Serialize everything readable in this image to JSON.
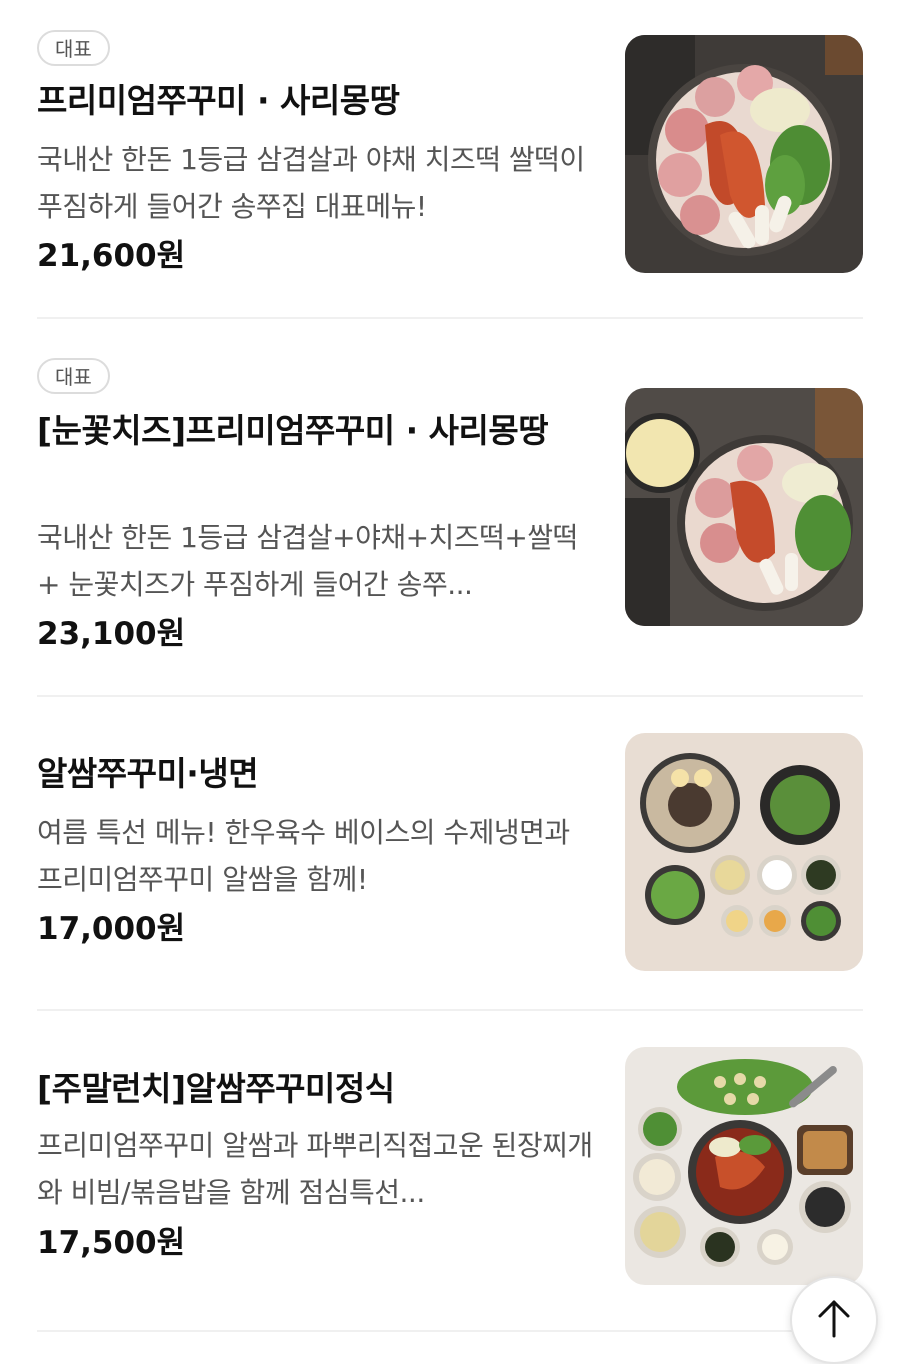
{
  "menu": {
    "items": [
      {
        "badge": "대표",
        "title": "프리미엄쭈꾸미 · 사리몽땅",
        "description": "국내산 한돈 1등급 삼겹살과 야채 치즈떡 쌀떡이 푸짐하게 들어간 송쭈집 대표메뉴!",
        "price": "21,600원",
        "image_icon": "premium-jjukkumi-dish-photo"
      },
      {
        "badge": "대표",
        "title": "[눈꽃치즈]프리미엄쭈꾸미 · 사리몽땅",
        "description": "국내산 한돈 1등급 삼겹살+야채+치즈떡+쌀떡+ 눈꽃치즈가 푸짐하게 들어간 송쭈...",
        "price": "23,100원",
        "image_icon": "snow-cheese-jjukkumi-dish-photo"
      },
      {
        "badge": "",
        "title": "알쌈쭈꾸미·냉면",
        "description": "여름 특선 메뉴! 한우육수 베이스의 수제냉면과 프리미엄쭈꾸미 알쌈을 함께!",
        "price": "17,000원",
        "image_icon": "naengmyeon-set-photo"
      },
      {
        "badge": "",
        "title": "[주말런치]알쌈쭈꾸미정식",
        "description": "프리미엄쭈꾸미 알쌈과 파뿌리직접고운 된장찌개와 비빔/볶음밥을 함께 점심특선...",
        "price": "17,500원",
        "image_icon": "weekend-lunch-set-photo"
      }
    ]
  },
  "scroll_top": {
    "icon": "arrow-up-icon"
  },
  "colors": {
    "text_primary": "#111111",
    "text_secondary": "#555555",
    "badge_border": "#dcdcdc",
    "divider": "#f0f0f0"
  }
}
